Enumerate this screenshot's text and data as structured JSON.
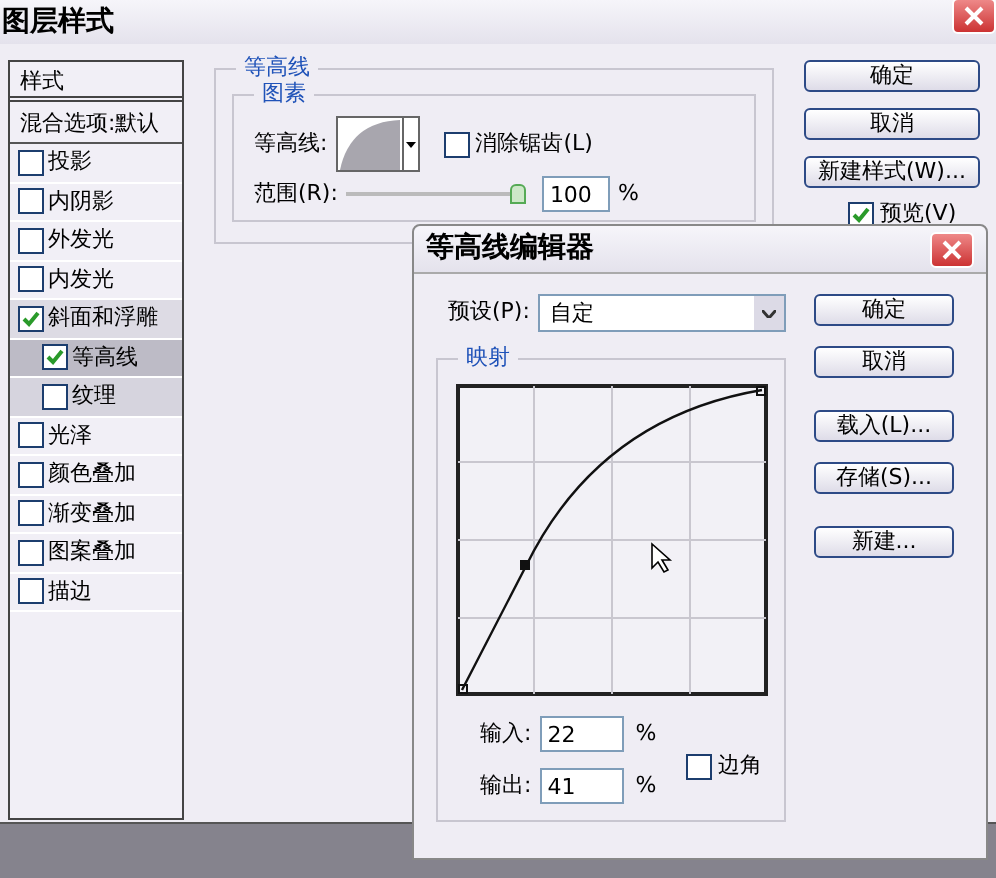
{
  "window": {
    "title": "图层样式"
  },
  "styles_panel": {
    "header": "样式",
    "blend_options": "混合选项:默认",
    "items": [
      {
        "label": "投影",
        "checked": false,
        "selected": false
      },
      {
        "label": "内阴影",
        "checked": false,
        "selected": false
      },
      {
        "label": "外发光",
        "checked": false,
        "selected": false
      },
      {
        "label": "内发光",
        "checked": false,
        "selected": false
      },
      {
        "label": "斜面和浮雕",
        "checked": true,
        "selected": false,
        "children": [
          {
            "label": "等高线",
            "checked": true,
            "selected": true
          },
          {
            "label": "纹理",
            "checked": false,
            "selected": false
          }
        ]
      },
      {
        "label": "光泽",
        "checked": false,
        "selected": false
      },
      {
        "label": "颜色叠加",
        "checked": false,
        "selected": false
      },
      {
        "label": "渐变叠加",
        "checked": false,
        "selected": false
      },
      {
        "label": "图案叠加",
        "checked": false,
        "selected": false
      },
      {
        "label": "描边",
        "checked": false,
        "selected": false
      }
    ]
  },
  "contour_group": {
    "title": "等高线",
    "elements": {
      "title": "图素",
      "contour_label": "等高线:",
      "anti_alias": {
        "label": "消除锯齿(L)",
        "checked": false
      },
      "range_label": "范围(R):",
      "range": {
        "level": 1.0,
        "value": "100",
        "unit": "%"
      }
    }
  },
  "buttons": [
    "确定",
    "取消",
    "新建样式(W)..."
  ],
  "preview": {
    "label": "预览(V)",
    "checked": true
  },
  "contour_editor": {
    "title": "等高线编辑器",
    "preset_label": "预设(P):",
    "preset": "自定",
    "mapping_title": "映射",
    "input_label": "输入:",
    "input": "22",
    "input_unit": "%",
    "output_label": "输出:",
    "output": "41",
    "output_unit": "%",
    "corner": {
      "label": "边角",
      "checked": false
    },
    "buttons": [
      "确定",
      "取消",
      "载入(L)...",
      "存储(S)...",
      "新建..."
    ]
  }
}
